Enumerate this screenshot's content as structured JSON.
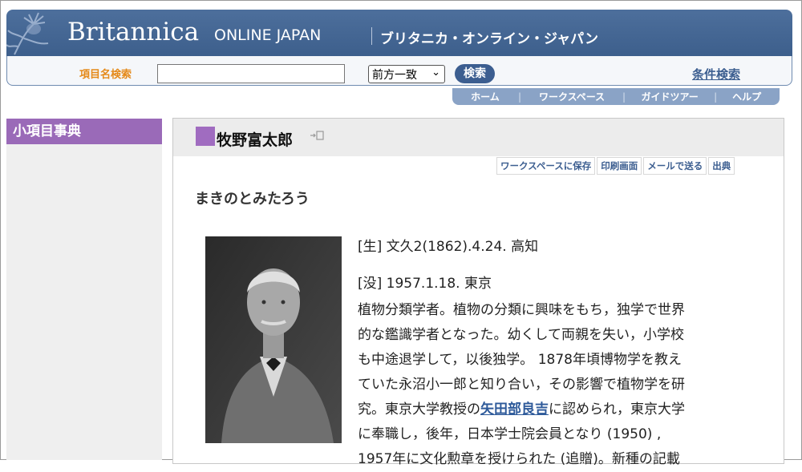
{
  "header": {
    "brand": "Britannica",
    "brand_sub": "ONLINE JAPAN",
    "brand_jp": "ブリタニカ・オンライン・ジャパン"
  },
  "search": {
    "label": "項目名検索",
    "input_value": "",
    "mode_selected": "前方一致",
    "button": "検索",
    "advanced_link": "条件検索"
  },
  "nav": {
    "items": [
      {
        "label": "ホーム"
      },
      {
        "label": "ワークスペース"
      },
      {
        "label": "ガイドツアー"
      },
      {
        "label": "ヘルプ"
      }
    ]
  },
  "sidebar": {
    "header": "小項目事典"
  },
  "article": {
    "title": "牧野富太郎",
    "tools": [
      {
        "label": "ワークスペースに保存"
      },
      {
        "label": "印刷画面"
      },
      {
        "label": "メールで送る"
      },
      {
        "label": "出典"
      }
    ],
    "reading": "まきのとみたろう",
    "born": "[生] 文久2(1862).4.24. 高知",
    "died": "[没] 1957.1.18. 東京",
    "body_lines": [
      "植物分類学者。植物の分類に興味をもち，独学で世界",
      "的な鑑識学者となった。幼くして両親を失い，小学校",
      "も中途退学して，以後独学。 1878年頃博物学を教え",
      "ていた永沼小一郎と知り合い，その影響で植物学を研"
    ],
    "body_line5_before": "究。東京大学教授の",
    "body_link": "矢田部良吉",
    "body_line5_after": "に認められ，東京大学",
    "body_line6": "に奉職し，後年，日本学士院会員となり (1950) ,",
    "body_line7": "1957年に文化勲章を授けられた (追贈)。新種の記載"
  },
  "colors": {
    "header_blue": "#3d5f8c",
    "sidebar_purple": "#9a6ab8",
    "title_square": "#a06cc0",
    "search_label_orange": "#e58a1a",
    "link_blue": "#2e5a9a"
  },
  "icons": {
    "logo": "thistle-logo-icon",
    "title_action": "export-icon",
    "select": "chevron-down-icon"
  }
}
